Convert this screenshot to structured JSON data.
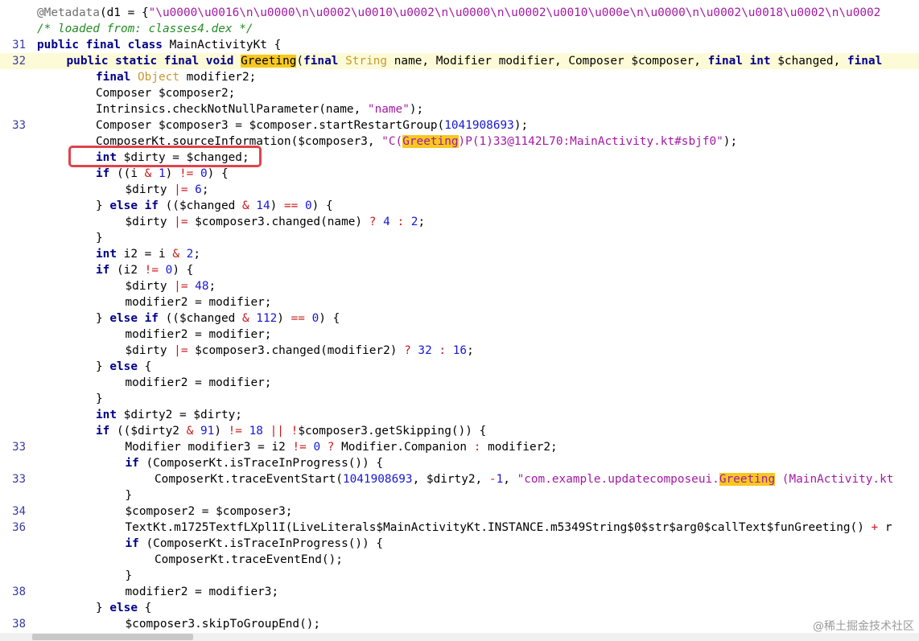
{
  "editor": {
    "lines": [
      {
        "n": "",
        "indent": 0,
        "tokens": [
          [
            "ann",
            "@Metadata"
          ],
          [
            "p",
            "(d1 = {"
          ],
          [
            "str",
            "\"\\u0000\\u0016\\n\\u0000\\n\\u0002\\u0010\\u0002\\n\\u0000\\n\\u0002\\u0010\\u000e\\n\\u0000\\n\\u0002\\u0018\\u0002\\n\\u0002"
          ]
        ]
      },
      {
        "n": "",
        "indent": 0,
        "tokens": [
          [
            "cm",
            "/* loaded from: classes4.dex */"
          ]
        ]
      },
      {
        "n": "31",
        "indent": 0,
        "tokens": [
          [
            "kw",
            "public final class"
          ],
          [
            "p",
            " MainActivityKt {"
          ]
        ]
      },
      {
        "n": "32",
        "indent": 1,
        "current": true,
        "tokens": [
          [
            "kw",
            "public static final void"
          ],
          [
            "p",
            " "
          ],
          [
            "hlp",
            "Greeting"
          ],
          [
            "p",
            "("
          ],
          [
            "kw",
            "final"
          ],
          [
            "p",
            " "
          ],
          [
            "ty",
            "String"
          ],
          [
            "p",
            " name, Modifier modifier, Composer $composer, "
          ],
          [
            "kw",
            "final int"
          ],
          [
            "p",
            " $changed, "
          ],
          [
            "kw",
            "final"
          ]
        ]
      },
      {
        "n": "",
        "indent": 2,
        "tokens": [
          [
            "kw",
            "final"
          ],
          [
            "p",
            " "
          ],
          [
            "ty",
            "Object"
          ],
          [
            "p",
            " modifier2;"
          ]
        ]
      },
      {
        "n": "",
        "indent": 2,
        "tokens": [
          [
            "p",
            "Composer $composer2;"
          ]
        ]
      },
      {
        "n": "",
        "indent": 2,
        "tokens": [
          [
            "p",
            "Intrinsics.checkNotNullParameter(name, "
          ],
          [
            "str",
            "\"name\""
          ],
          [
            "p",
            ");"
          ]
        ]
      },
      {
        "n": "33",
        "indent": 2,
        "tokens": [
          [
            "p",
            "Composer $composer3 = $composer.startRestartGroup("
          ],
          [
            "num",
            "1041908693"
          ],
          [
            "p",
            ");"
          ]
        ]
      },
      {
        "n": "",
        "indent": 2,
        "tokens": [
          [
            "p",
            "ComposerKt.sourceInformation($composer3, "
          ],
          [
            "str",
            "\"C("
          ],
          [
            "hl",
            "Greeting"
          ],
          [
            "str",
            ")P(1)33@1142L70:MainActivity.kt#sbjf0\""
          ],
          [
            "p",
            ");"
          ]
        ]
      },
      {
        "n": "",
        "indent": 2,
        "tokens": [
          [
            "kw",
            "int"
          ],
          [
            "p",
            " $dirty = $changed;"
          ]
        ]
      },
      {
        "n": "",
        "indent": 2,
        "tokens": [
          [
            "kw",
            "if"
          ],
          [
            "p",
            " (("
          ],
          [
            "p",
            "i "
          ],
          [
            "op",
            "&"
          ],
          [
            "p",
            " "
          ],
          [
            "num",
            "1"
          ],
          [
            "p",
            ") "
          ],
          [
            "op",
            "!="
          ],
          [
            "p",
            " "
          ],
          [
            "num",
            "0"
          ],
          [
            "p",
            ") {"
          ]
        ]
      },
      {
        "n": "",
        "indent": 3,
        "tokens": [
          [
            "p",
            "$dirty "
          ],
          [
            "op",
            "|="
          ],
          [
            "p",
            " "
          ],
          [
            "num",
            "6"
          ],
          [
            "p",
            ";"
          ]
        ]
      },
      {
        "n": "",
        "indent": 2,
        "tokens": [
          [
            "p",
            "} "
          ],
          [
            "kw",
            "else if"
          ],
          [
            "p",
            " (($changed "
          ],
          [
            "op",
            "&"
          ],
          [
            "p",
            " "
          ],
          [
            "num",
            "14"
          ],
          [
            "p",
            ") "
          ],
          [
            "op",
            "=="
          ],
          [
            "p",
            " "
          ],
          [
            "num",
            "0"
          ],
          [
            "p",
            ") {"
          ]
        ]
      },
      {
        "n": "",
        "indent": 3,
        "tokens": [
          [
            "p",
            "$dirty "
          ],
          [
            "op",
            "|="
          ],
          [
            "p",
            " $composer3.changed(name) "
          ],
          [
            "op",
            "?"
          ],
          [
            "p",
            " "
          ],
          [
            "num",
            "4"
          ],
          [
            "p",
            " "
          ],
          [
            "op",
            ":"
          ],
          [
            "p",
            " "
          ],
          [
            "num",
            "2"
          ],
          [
            "p",
            ";"
          ]
        ]
      },
      {
        "n": "",
        "indent": 2,
        "tokens": [
          [
            "p",
            "}"
          ]
        ]
      },
      {
        "n": "",
        "indent": 2,
        "tokens": [
          [
            "kw",
            "int"
          ],
          [
            "p",
            " i2 = i "
          ],
          [
            "op",
            "&"
          ],
          [
            "p",
            " "
          ],
          [
            "num",
            "2"
          ],
          [
            "p",
            ";"
          ]
        ]
      },
      {
        "n": "",
        "indent": 2,
        "tokens": [
          [
            "kw",
            "if"
          ],
          [
            "p",
            " (i2 "
          ],
          [
            "op",
            "!="
          ],
          [
            "p",
            " "
          ],
          [
            "num",
            "0"
          ],
          [
            "p",
            ") {"
          ]
        ]
      },
      {
        "n": "",
        "indent": 3,
        "tokens": [
          [
            "p",
            "$dirty "
          ],
          [
            "op",
            "|="
          ],
          [
            "p",
            " "
          ],
          [
            "num",
            "48"
          ],
          [
            "p",
            ";"
          ]
        ]
      },
      {
        "n": "",
        "indent": 3,
        "tokens": [
          [
            "p",
            "modifier2 = modifier;"
          ]
        ]
      },
      {
        "n": "",
        "indent": 2,
        "tokens": [
          [
            "p",
            "} "
          ],
          [
            "kw",
            "else if"
          ],
          [
            "p",
            " (($changed "
          ],
          [
            "op",
            "&"
          ],
          [
            "p",
            " "
          ],
          [
            "num",
            "112"
          ],
          [
            "p",
            ") "
          ],
          [
            "op",
            "=="
          ],
          [
            "p",
            " "
          ],
          [
            "num",
            "0"
          ],
          [
            "p",
            ") {"
          ]
        ]
      },
      {
        "n": "",
        "indent": 3,
        "tokens": [
          [
            "p",
            "modifier2 = modifier;"
          ]
        ]
      },
      {
        "n": "",
        "indent": 3,
        "tokens": [
          [
            "p",
            "$dirty "
          ],
          [
            "op",
            "|="
          ],
          [
            "p",
            " $composer3.changed(modifier2) "
          ],
          [
            "op",
            "?"
          ],
          [
            "p",
            " "
          ],
          [
            "num",
            "32"
          ],
          [
            "p",
            " "
          ],
          [
            "op",
            ":"
          ],
          [
            "p",
            " "
          ],
          [
            "num",
            "16"
          ],
          [
            "p",
            ";"
          ]
        ]
      },
      {
        "n": "",
        "indent": 2,
        "tokens": [
          [
            "p",
            "} "
          ],
          [
            "kw",
            "else"
          ],
          [
            "p",
            " {"
          ]
        ]
      },
      {
        "n": "",
        "indent": 3,
        "tokens": [
          [
            "p",
            "modifier2 = modifier;"
          ]
        ]
      },
      {
        "n": "",
        "indent": 2,
        "tokens": [
          [
            "p",
            "}"
          ]
        ]
      },
      {
        "n": "",
        "indent": 2,
        "tokens": [
          [
            "kw",
            "int"
          ],
          [
            "p",
            " $dirty2 = $dirty;"
          ]
        ]
      },
      {
        "n": "",
        "indent": 2,
        "tokens": [
          [
            "kw",
            "if"
          ],
          [
            "p",
            " (($dirty2 "
          ],
          [
            "op",
            "&"
          ],
          [
            "p",
            " "
          ],
          [
            "num",
            "91"
          ],
          [
            "p",
            ") "
          ],
          [
            "op",
            "!="
          ],
          [
            "p",
            " "
          ],
          [
            "num",
            "18"
          ],
          [
            "p",
            " "
          ],
          [
            "op",
            "||"
          ],
          [
            "p",
            " "
          ],
          [
            "op",
            "!"
          ],
          [
            "p",
            "$composer3.getSkipping()) {"
          ]
        ]
      },
      {
        "n": "33",
        "indent": 3,
        "tokens": [
          [
            "p",
            "Modifier modifier3 = i2 "
          ],
          [
            "op",
            "!="
          ],
          [
            "p",
            " "
          ],
          [
            "num",
            "0"
          ],
          [
            "p",
            " "
          ],
          [
            "op",
            "?"
          ],
          [
            "p",
            " Modifier.Companion "
          ],
          [
            "op",
            ":"
          ],
          [
            "p",
            " modifier2;"
          ]
        ]
      },
      {
        "n": "",
        "indent": 3,
        "tokens": [
          [
            "kw",
            "if"
          ],
          [
            "p",
            " (ComposerKt.isTraceInProgress()) {"
          ]
        ]
      },
      {
        "n": "33",
        "indent": 4,
        "tokens": [
          [
            "p",
            "ComposerKt.traceEventStart("
          ],
          [
            "num",
            "1041908693"
          ],
          [
            "p",
            ", $dirty2, "
          ],
          [
            "op",
            "-"
          ],
          [
            "num",
            "1"
          ],
          [
            "p",
            ", "
          ],
          [
            "str",
            "\"com.example.updatecomposeui."
          ],
          [
            "hl",
            "Greeting"
          ],
          [
            "str",
            " (MainActivity.kt"
          ]
        ]
      },
      {
        "n": "",
        "indent": 3,
        "tokens": [
          [
            "p",
            "}"
          ]
        ]
      },
      {
        "n": "34",
        "indent": 3,
        "tokens": [
          [
            "p",
            "$composer2 = $composer3;"
          ]
        ]
      },
      {
        "n": "36",
        "indent": 3,
        "tokens": [
          [
            "p",
            "TextKt.m1725TextfLXpl1I(LiveLiterals$MainActivityKt.INSTANCE.m5349String$0$str$arg0$callText$funGreeting() "
          ],
          [
            "op",
            "+"
          ],
          [
            "p",
            " r"
          ]
        ]
      },
      {
        "n": "",
        "indent": 3,
        "tokens": [
          [
            "kw",
            "if"
          ],
          [
            "p",
            " (ComposerKt.isTraceInProgress()) {"
          ]
        ]
      },
      {
        "n": "",
        "indent": 4,
        "tokens": [
          [
            "p",
            "ComposerKt.traceEventEnd();"
          ]
        ]
      },
      {
        "n": "",
        "indent": 3,
        "tokens": [
          [
            "p",
            "}"
          ]
        ]
      },
      {
        "n": "38",
        "indent": 3,
        "tokens": [
          [
            "p",
            "modifier2 = modifier3;"
          ]
        ]
      },
      {
        "n": "",
        "indent": 2,
        "tokens": [
          [
            "p",
            "} "
          ],
          [
            "kw",
            "else"
          ],
          [
            "p",
            " {"
          ]
        ]
      },
      {
        "n": "38",
        "indent": 3,
        "tokens": [
          [
            "p",
            "$composer3.skipToGroupEnd();"
          ]
        ]
      }
    ]
  },
  "watermark": {
    "text": "@稀土掘金技术社区"
  }
}
